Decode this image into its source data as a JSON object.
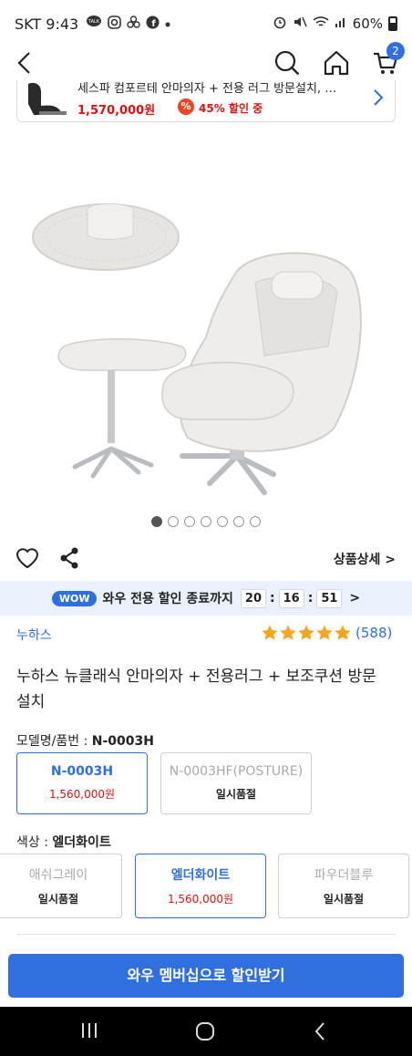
{
  "status": {
    "carrier_time": "SKT 9:43",
    "icons": [
      "talk-icon",
      "instagram-icon",
      "pinwheel-icon",
      "facebook-icon",
      "dot-icon"
    ],
    "battery": "60%"
  },
  "header": {
    "cart_count": "2"
  },
  "recent_product": {
    "title": "세스파 컴포르테 안마의자 + 전용 러그 방문설치, …",
    "price": "1,570,000원",
    "discount": "45% 할인 중",
    "pct_symbol": "%"
  },
  "gallery": {
    "total": 7,
    "active_index": 0
  },
  "actions": {
    "detail_link": "상품상세 >"
  },
  "wow": {
    "badge": "WOW",
    "text": "와우 전용 할인 종료까지",
    "hours": "20",
    "minutes": "16",
    "seconds": "51",
    "sep": ":",
    "chevron": ">"
  },
  "product": {
    "brand": "누하스",
    "rating_stars": 5,
    "rating_count": "(588)",
    "title": "누하스 뉴클래식 안마의자 + 전용러그 + 보조쿠션 방문설치"
  },
  "model": {
    "label": "모델명/품번 :",
    "selected": "N-0003H",
    "options": [
      {
        "name": "N-0003H",
        "value": "1,560,000원"
      },
      {
        "name": "N-0003HF(POSTURE)",
        "value": "일시품절"
      }
    ]
  },
  "color": {
    "label": "색상 :",
    "selected": "엘더화이트",
    "options": [
      {
        "name": "애쉬그레이",
        "value": "일시품절"
      },
      {
        "name": "엘더화이트",
        "value": "1,560,000원"
      },
      {
        "name": "파우더블루",
        "value": "일시품절"
      }
    ]
  },
  "cta": {
    "label": "와우 멤버십으로 할인받기"
  },
  "colors": {
    "accent": "#2f6fde",
    "price": "#dd1111",
    "star": "#f5a623"
  }
}
